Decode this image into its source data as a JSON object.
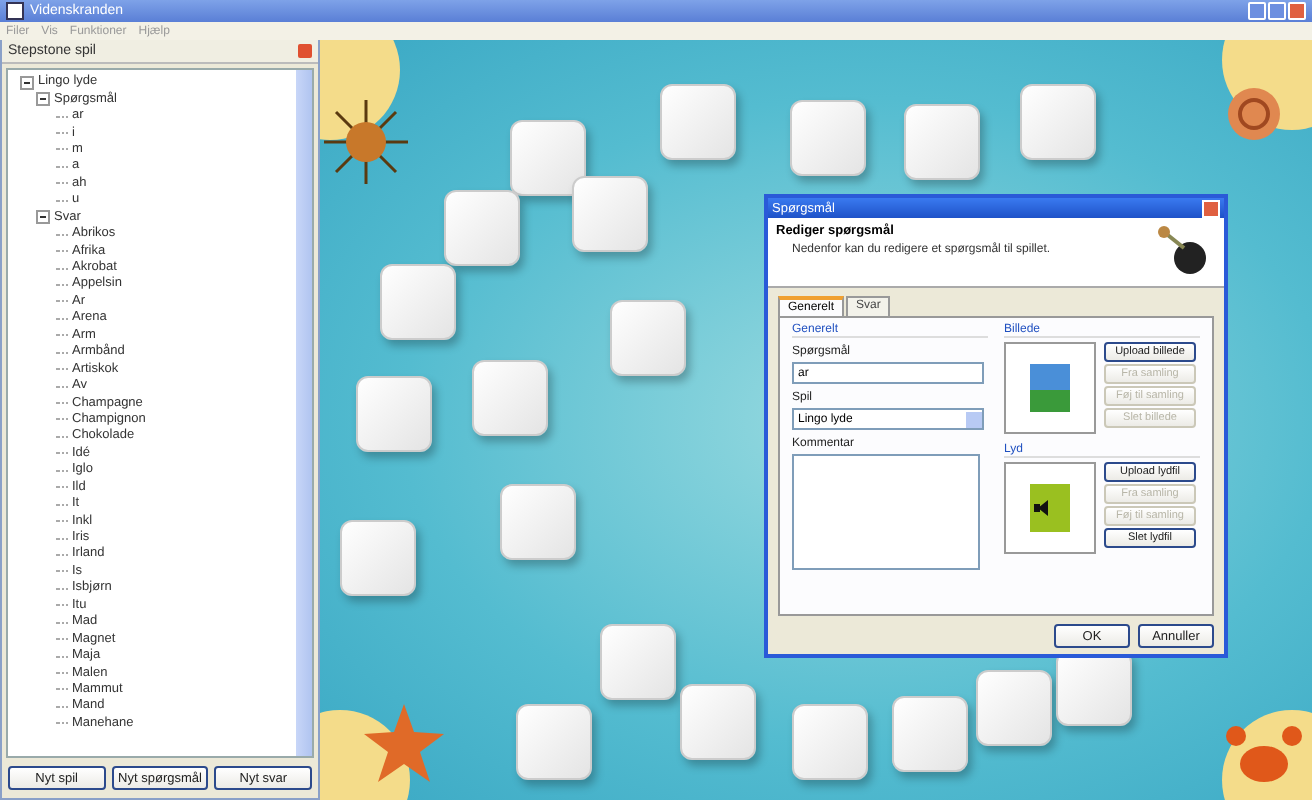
{
  "window": {
    "title": "Videnskranden"
  },
  "menu": [
    "Filer",
    "Vis",
    "Funktioner",
    "Hjælp"
  ],
  "sidebar": {
    "title": "Stepstone spil",
    "tree": [
      {
        "label": "Lingo lyde",
        "expanded": true,
        "children": [
          {
            "label": "Spørgsmål",
            "expanded": true,
            "children": [
              {
                "label": "ar"
              },
              {
                "label": "i"
              },
              {
                "label": "m"
              },
              {
                "label": "a"
              },
              {
                "label": "ah"
              },
              {
                "label": "u"
              }
            ]
          },
          {
            "label": "Svar",
            "expanded": true,
            "children": [
              {
                "label": "Abrikos"
              },
              {
                "label": "Afrika"
              },
              {
                "label": "Akrobat"
              },
              {
                "label": "Appelsin"
              },
              {
                "label": "Ar"
              },
              {
                "label": "Arena"
              },
              {
                "label": "Arm"
              },
              {
                "label": "Armbånd"
              },
              {
                "label": "Artiskok"
              },
              {
                "label": "Av"
              },
              {
                "label": "Champagne"
              },
              {
                "label": "Champignon"
              },
              {
                "label": "Chokolade"
              },
              {
                "label": "Idé"
              },
              {
                "label": "Iglo"
              },
              {
                "label": "Ild"
              },
              {
                "label": "It"
              },
              {
                "label": "Inkl"
              },
              {
                "label": "Iris"
              },
              {
                "label": "Irland"
              },
              {
                "label": "Is"
              },
              {
                "label": "Isbjørn"
              },
              {
                "label": "Itu"
              },
              {
                "label": "Mad"
              },
              {
                "label": "Magnet"
              },
              {
                "label": "Maja"
              },
              {
                "label": "Malen"
              },
              {
                "label": "Mammut"
              },
              {
                "label": "Mand"
              },
              {
                "label": "Manehane"
              }
            ]
          }
        ]
      }
    ],
    "buttons": [
      "Nyt spil",
      "Nyt spørgsmål",
      "Nyt svar"
    ]
  },
  "dialog": {
    "title": "Spørgsmål",
    "heading": "Rediger spørgsmål",
    "description": "Nedenfor kan du redigere et spørgsmål til spillet.",
    "tabs": [
      {
        "label": "Generelt",
        "selected": true
      },
      {
        "label": "Svar",
        "selected": false
      }
    ],
    "general": {
      "title": "Generelt",
      "question_label": "Spørgsmål",
      "question_value": "ar",
      "game_label": "Spil",
      "game_value": "Lingo lyde",
      "comment_label": "Kommentar"
    },
    "image": {
      "title": "Billede",
      "buttons": [
        {
          "label": "Upload billede",
          "disabled": false
        },
        {
          "label": "Fra samling",
          "disabled": true
        },
        {
          "label": "Føj til samling",
          "disabled": true
        },
        {
          "label": "Slet billede",
          "disabled": true
        }
      ]
    },
    "sound": {
      "title": "Lyd",
      "buttons": [
        {
          "label": "Upload lydfil",
          "disabled": false
        },
        {
          "label": "Fra samling",
          "disabled": true
        },
        {
          "label": "Føj til samling",
          "disabled": true
        },
        {
          "label": "Slet lydfil",
          "disabled": false
        }
      ]
    },
    "footer": [
      "OK",
      "Annuller"
    ]
  }
}
